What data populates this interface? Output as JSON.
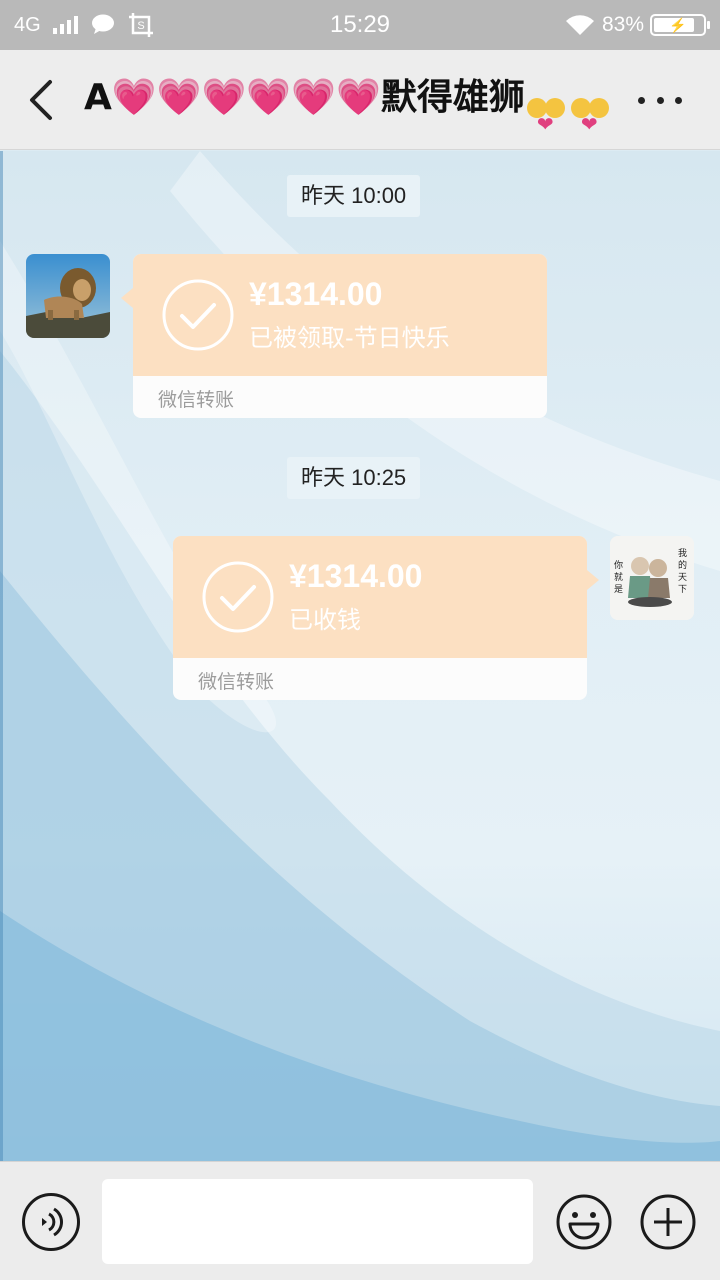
{
  "status_bar": {
    "network": "4G",
    "time": "15:29",
    "battery_percent": "83%",
    "battery_level": 0.83,
    "icons": [
      "signal-icon",
      "message-icon",
      "screenshot-icon",
      "wifi-icon",
      "battery-icon"
    ]
  },
  "header": {
    "title_prefix": "A",
    "title_hearts": "💗💗💗💗💗💗",
    "title_name": "默得雄狮",
    "back_icon": "chevron-left-icon",
    "more_icon": "more-dots-icon"
  },
  "messages": [
    {
      "timestamp": "昨天 10:00",
      "side": "left",
      "amount": "¥1314.00",
      "status": "已被领取-节日快乐",
      "footer": "微信转账",
      "avatar": "lion-avatar"
    },
    {
      "timestamp": "昨天 10:25",
      "side": "right",
      "amount": "¥1314.00",
      "status": "已收钱",
      "footer": "微信转账",
      "avatar": "couple-avatar",
      "avatar_text_left": "你就是",
      "avatar_text_right": "我的天下"
    }
  ],
  "input_bar": {
    "placeholder": "",
    "voice_icon": "voice-icon",
    "emoji_icon": "emoji-icon",
    "plus_icon": "plus-icon"
  },
  "colors": {
    "status_bar": "#b9b9b9",
    "header": "#ededed",
    "transfer_card": "#fce0c2",
    "input_bar": "#ececec"
  }
}
